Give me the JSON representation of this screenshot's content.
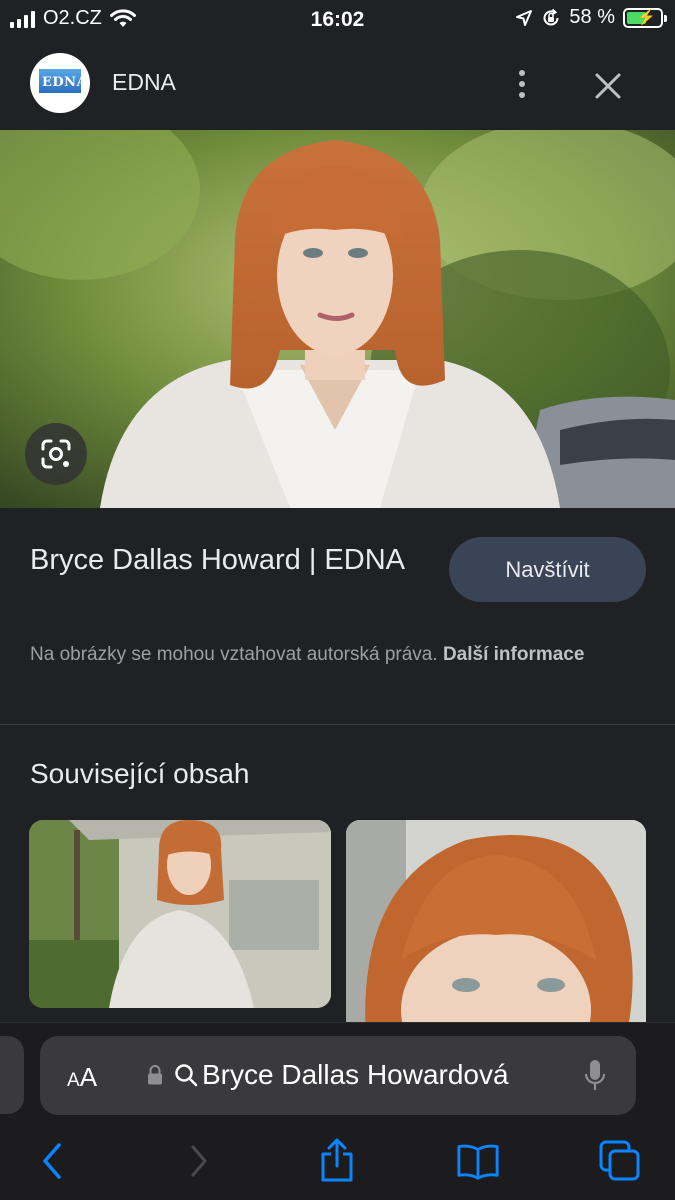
{
  "status_bar": {
    "carrier": "O2.CZ",
    "time": "16:02",
    "battery_percent": "58 %",
    "battery_level": 0.58,
    "icons": [
      "signal-icon",
      "wifi-icon",
      "location-arrow-icon",
      "orientation-lock-icon",
      "battery-charging-icon"
    ]
  },
  "header": {
    "site_logo_text": "EDNA",
    "site_name": "EDNA",
    "icons": [
      "more-vert-icon",
      "close-icon"
    ]
  },
  "hero": {
    "icon": "lens-search-icon"
  },
  "result": {
    "title": "Bryce Dallas Howard | EDNA",
    "visit_label": "Navštívit",
    "copyright_text": "Na obrázky se mohou vztahovat autorská práva.",
    "more_info_label": "Další informace"
  },
  "related": {
    "heading": "Související obsah"
  },
  "browser": {
    "aa_small": "A",
    "aa_large": "A",
    "address_text": "Bryce Dallas Howardová",
    "icons": [
      "lock-icon",
      "search-icon",
      "microphone-icon",
      "back-icon",
      "forward-icon",
      "share-icon",
      "bookmarks-icon",
      "tabs-icon"
    ]
  },
  "colors": {
    "background": "#202124",
    "visit_button": "#394457",
    "browser_bar": "#1c1c1e",
    "accent_blue": "#0a84ff",
    "battery_green": "#4cd964"
  }
}
